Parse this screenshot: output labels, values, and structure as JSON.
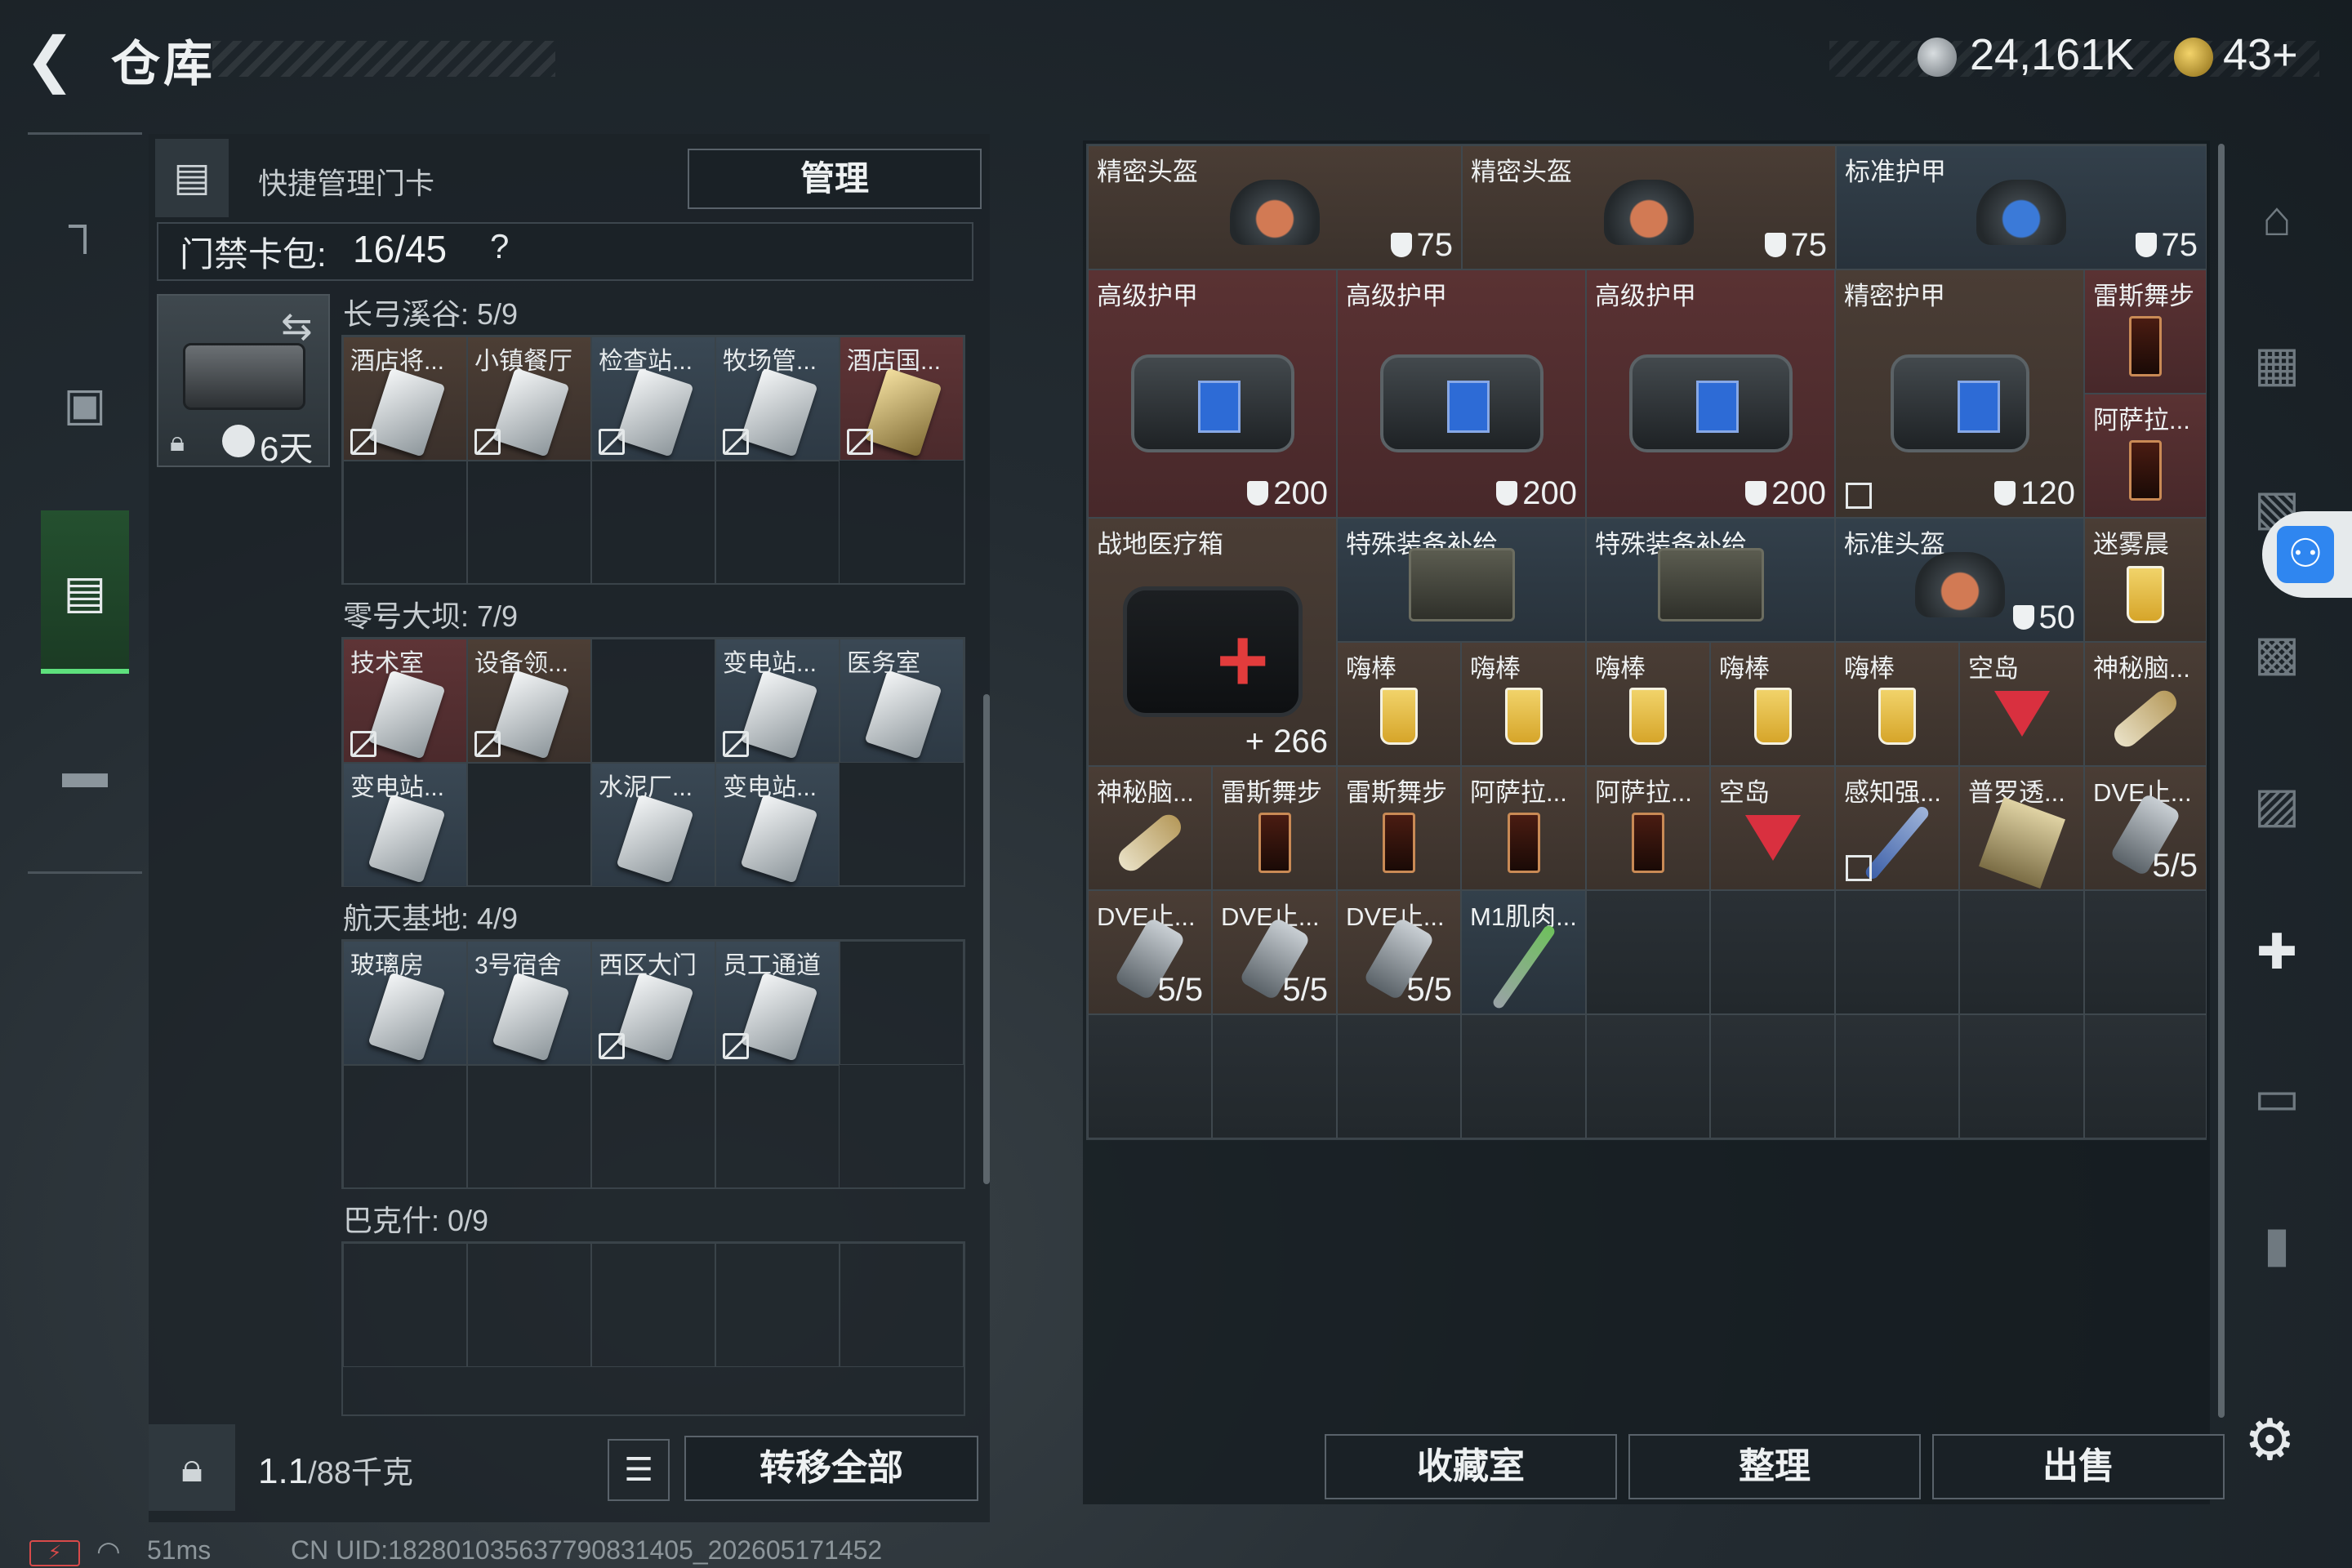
{
  "header": {
    "title": "仓库",
    "currency1": "24,161K",
    "currency2": "43+"
  },
  "icons": {
    "back": "back-arrow-icon",
    "currency1": "silver-coin-icon",
    "currency2": "gold-coin-icon"
  },
  "left_nav": [
    "pistol-icon",
    "backpack-icon",
    "keycard-holder-icon",
    "briefcase-icon"
  ],
  "quick_manage": {
    "label": "快捷管理门卡",
    "manage_button": "管理"
  },
  "card_pack": {
    "label": "门禁卡包:",
    "value": "16/45",
    "help": "?"
  },
  "holder": {
    "days": "6天"
  },
  "groups": [
    {
      "title": "长弓溪谷: 5/9"
    },
    {
      "title": "零号大坝: 7/9"
    },
    {
      "title": "航天基地: 4/9"
    },
    {
      "title": "巴克什: 0/9"
    }
  ],
  "cards": {
    "g1": [
      "酒店将...",
      "小镇餐厅",
      "检查站...",
      "牧场管...",
      "酒店国..."
    ],
    "g2": [
      "技术室",
      "设备领...",
      "变电站...",
      "医务室",
      "变电站...",
      "水泥厂...",
      "变电站..."
    ],
    "g3": [
      "玻璃房",
      "3号宿舍",
      "西区大门",
      "员工通道"
    ]
  },
  "bottom_left": {
    "weight": "1.1",
    "weight_unit": "/88千克",
    "transfer_all": "转移全部"
  },
  "status": {
    "battery": "⚡",
    "ping": "51ms",
    "uid": "CN UID:18280103563779083140​5_202605171452"
  },
  "items": [
    {
      "name": "精密头盔",
      "value": "75"
    },
    {
      "name": "精密头盔",
      "value": "75"
    },
    {
      "name": "标准护甲",
      "value": "75"
    },
    {
      "name": "高级护甲",
      "value": "200"
    },
    {
      "name": "高级护甲",
      "value": "200"
    },
    {
      "name": "高级护甲",
      "value": "200"
    },
    {
      "name": "精密护甲",
      "value": "120"
    },
    {
      "name": "雷斯舞步",
      "value": ""
    },
    {
      "name": "阿萨拉...",
      "value": ""
    },
    {
      "name": "战地医疗箱",
      "value": "266"
    },
    {
      "name": "特殊装备补给",
      "value": ""
    },
    {
      "name": "特殊装备补给",
      "value": ""
    },
    {
      "name": "标准头盔",
      "value": "50"
    },
    {
      "name": "迷雾晨",
      "value": ""
    },
    {
      "name": "嗨棒",
      "value": ""
    },
    {
      "name": "嗨棒",
      "value": ""
    },
    {
      "name": "嗨棒",
      "value": ""
    },
    {
      "name": "嗨棒",
      "value": ""
    },
    {
      "name": "嗨棒",
      "value": ""
    },
    {
      "name": "空岛",
      "value": ""
    },
    {
      "name": "神秘脑...",
      "value": ""
    },
    {
      "name": "神秘脑...",
      "value": ""
    },
    {
      "name": "雷斯舞步",
      "value": ""
    },
    {
      "name": "雷斯舞步",
      "value": ""
    },
    {
      "name": "阿萨拉...",
      "value": ""
    },
    {
      "name": "阿萨拉...",
      "value": ""
    },
    {
      "name": "空岛",
      "value": ""
    },
    {
      "name": "感知强...",
      "value": ""
    },
    {
      "name": "普罗透...",
      "value": ""
    },
    {
      "name": "DVE止...",
      "value": "5/5"
    },
    {
      "name": "DVE止...",
      "value": "5/5"
    },
    {
      "name": "DVE止...",
      "value": "5/5"
    },
    {
      "name": "DVE止...",
      "value": "5/5"
    },
    {
      "name": "M1肌肉...",
      "value": ""
    }
  ],
  "bottom_right": {
    "collection": "收藏室",
    "sort": "整理",
    "sell": "出售"
  },
  "right_nav": [
    "home-icon",
    "safe-box-icon",
    "chest-icon",
    "folder-icon",
    "crate-icon",
    "medkit-plus-icon",
    "truck-icon",
    "vehicle-icon"
  ],
  "colors": {
    "accent_green": "#5ee07d",
    "accessibility_blue": "#2f86f0"
  }
}
